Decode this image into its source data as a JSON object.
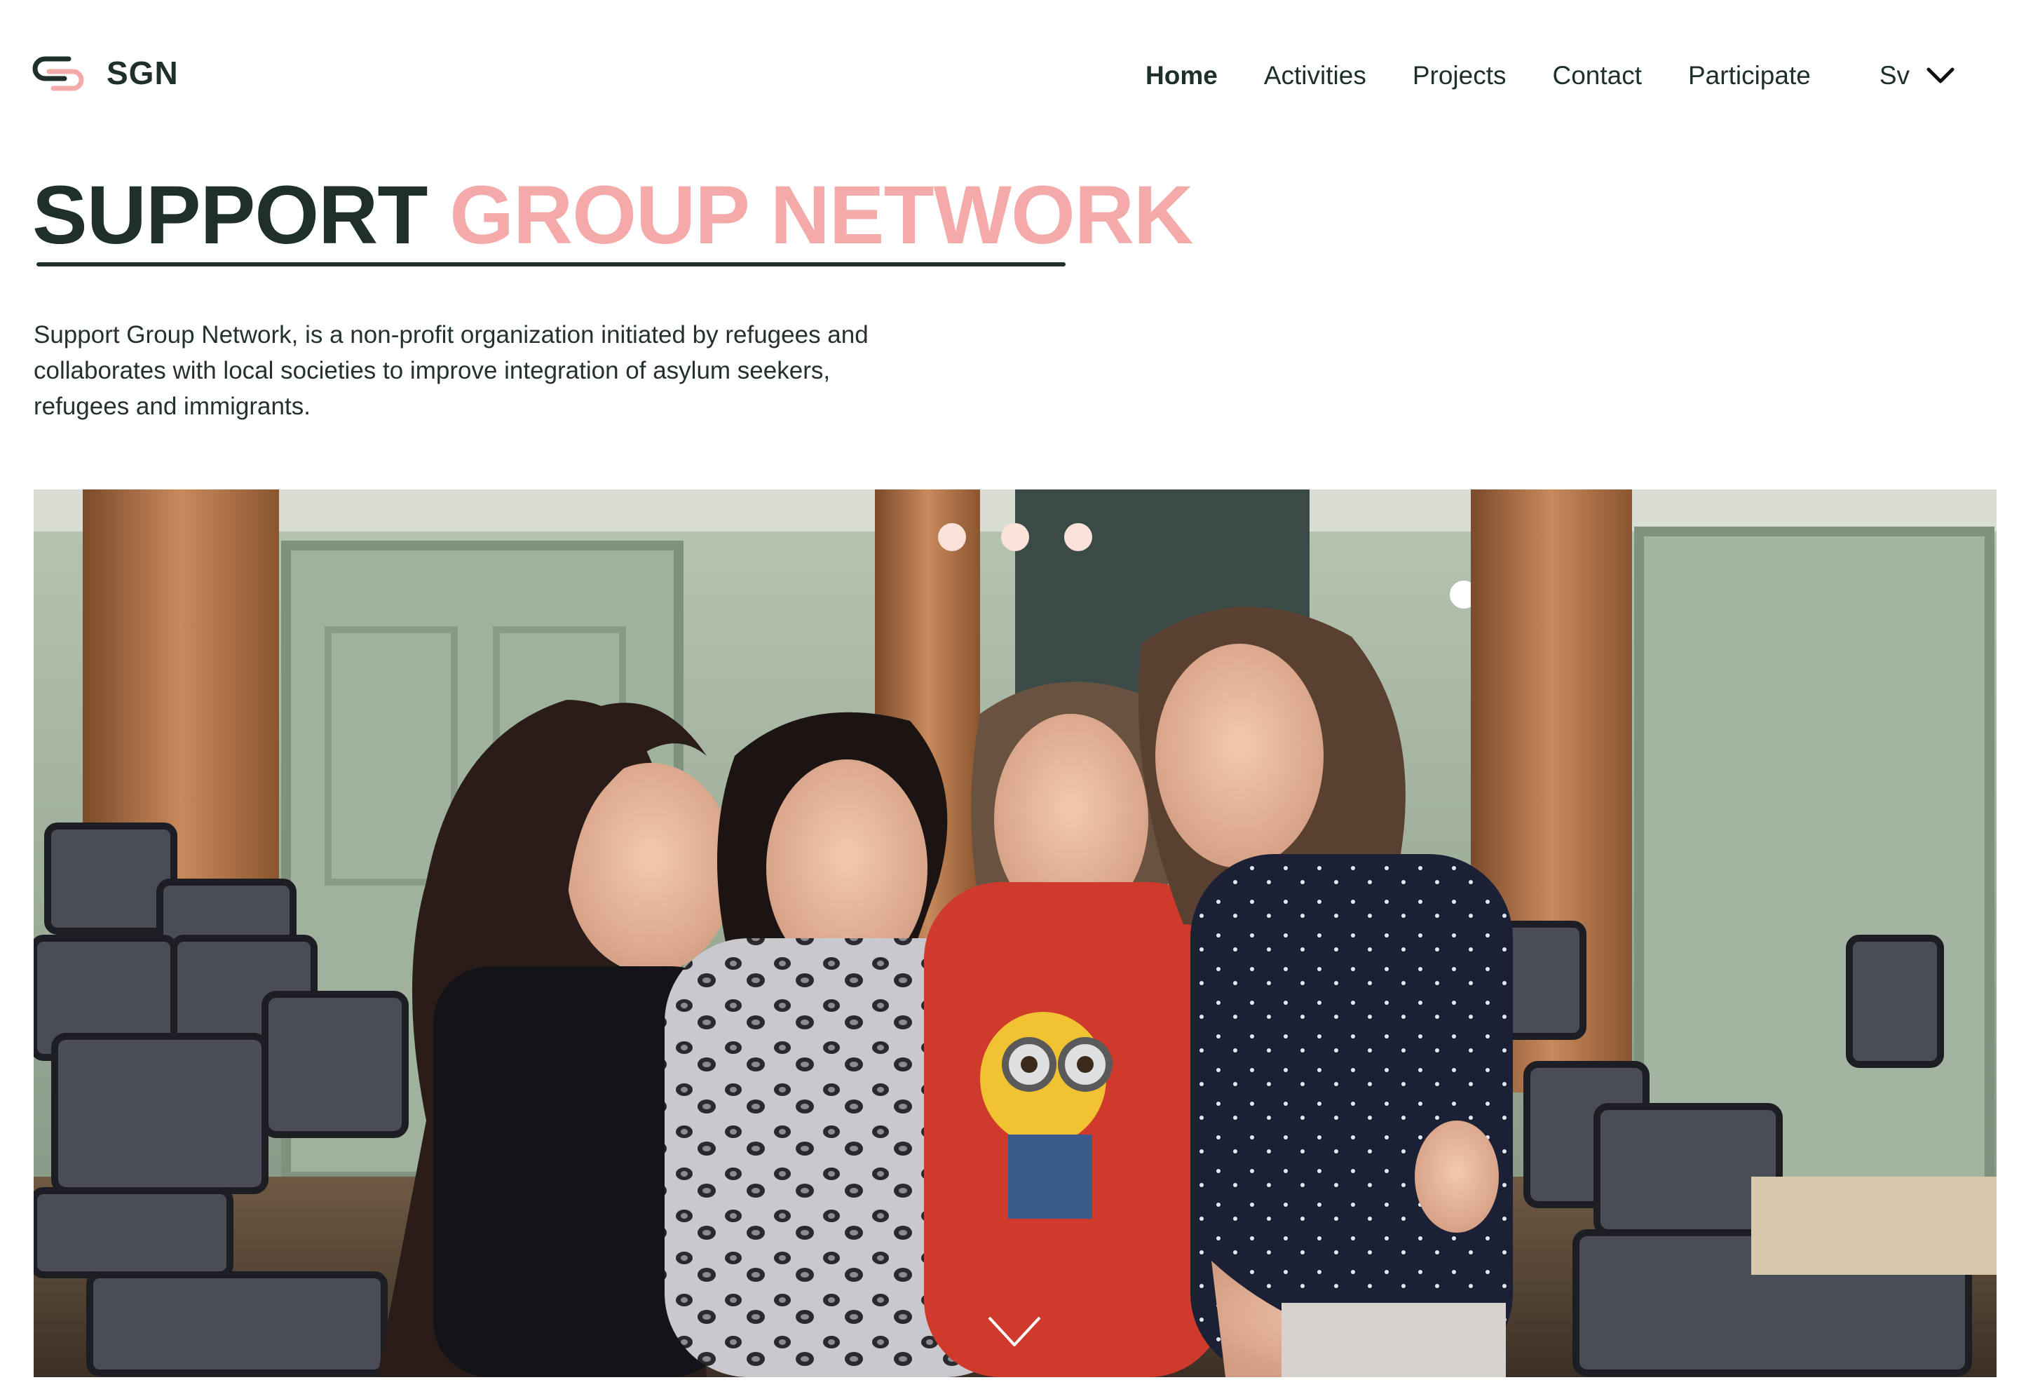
{
  "brand": {
    "name": "SGN",
    "colors": {
      "dark": "#1f2f2b",
      "accent_pink": "#f4aaa8",
      "dot": "#fbe3d9"
    }
  },
  "nav": {
    "items": [
      {
        "label": "Home",
        "active": true
      },
      {
        "label": "Activities",
        "active": false
      },
      {
        "label": "Projects",
        "active": false
      },
      {
        "label": "Contact",
        "active": false
      },
      {
        "label": "Participate",
        "active": false
      }
    ],
    "language": {
      "label": "Sv",
      "icon": "chevron-down-icon"
    }
  },
  "hero": {
    "title_part1": "SUPPORT",
    "title_part2": "GROUP NETWORK",
    "description": "Support Group Network, is a non-profit organization initiated by refugees and collaborates with local societies to improve integration of asylum seekers, refugees and immigrants."
  },
  "carousel": {
    "slide_count": 3,
    "icons": {
      "scroll": "chevron-down-icon"
    }
  }
}
